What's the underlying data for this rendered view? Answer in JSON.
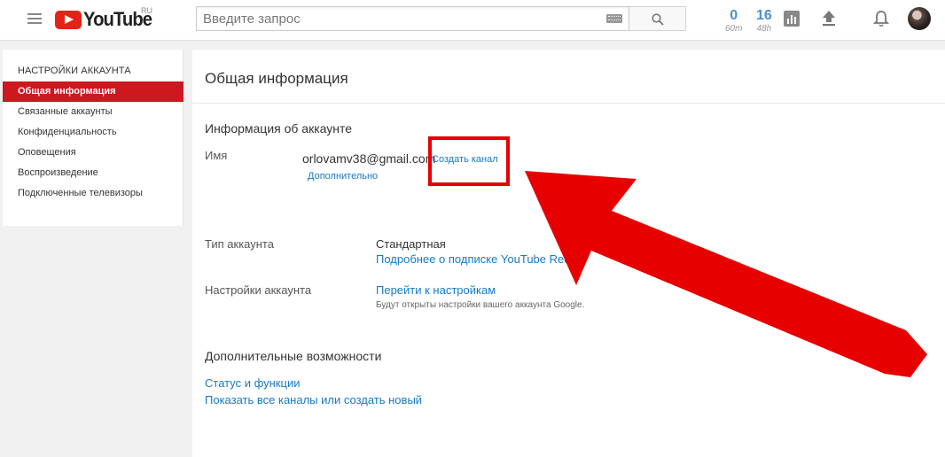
{
  "header": {
    "logo_text": "YouTube",
    "logo_region": "RU",
    "search_placeholder": "Введите запрос",
    "stats": [
      {
        "value": "0",
        "sub": "60m"
      },
      {
        "value": "16",
        "sub": "48h"
      }
    ]
  },
  "sidebar": {
    "heading": "Настройки аккаунта",
    "items": [
      {
        "label": "Общая информация"
      },
      {
        "label": "Связанные аккаунты"
      },
      {
        "label": "Конфиденциальность"
      },
      {
        "label": "Оповещения"
      },
      {
        "label": "Воспроизведение"
      },
      {
        "label": "Подключенные телевизоры"
      }
    ]
  },
  "main": {
    "title": "Общая информация",
    "account_info": {
      "heading": "Информация об аккаунте",
      "name_label": "Имя",
      "email": "orlovamv38@gmail.com",
      "create_channel": "Создать канал",
      "more": "Дополнительно"
    },
    "account_type": {
      "label": "Тип аккаунта",
      "value": "Стандартная",
      "link": "Подробнее о подписке YouTube Red"
    },
    "account_settings": {
      "label": "Настройки аккаунта",
      "link": "Перейти к настройкам",
      "hint": "Будут открыты настройки вашего аккаунта Google."
    },
    "extra": {
      "heading": "Дополнительные возможности",
      "links": [
        {
          "label": "Статус и функции"
        },
        {
          "label": "Показать все каналы или создать новый"
        }
      ]
    }
  },
  "colors": {
    "accent_red": "#cc181e",
    "link_blue": "#167ac6",
    "annotation_red": "#e60000"
  }
}
